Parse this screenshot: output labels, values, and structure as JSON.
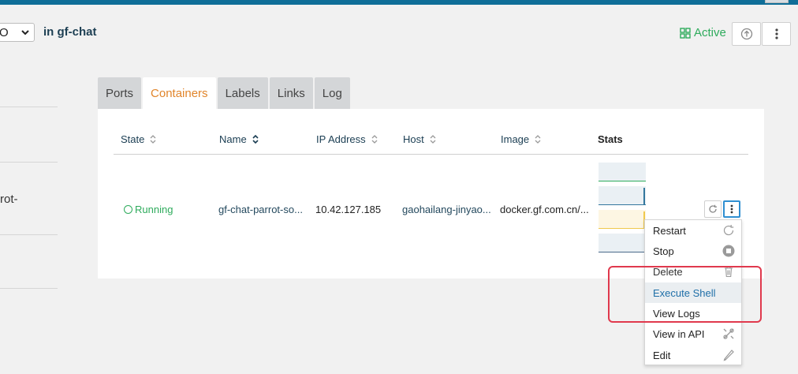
{
  "header": {
    "stack_select_value": "O",
    "in_label": "in",
    "stack_name": "gf-chat",
    "status": "Active",
    "status_color": "#2eab5c"
  },
  "left_panel": {
    "fragment": "rot-"
  },
  "tabs": [
    {
      "label": "Ports",
      "active": false
    },
    {
      "label": "Containers",
      "active": true
    },
    {
      "label": "Labels",
      "active": false
    },
    {
      "label": "Links",
      "active": false
    },
    {
      "label": "Log",
      "active": false
    }
  ],
  "table": {
    "columns": [
      {
        "label": "State",
        "sortable": true
      },
      {
        "label": "Name",
        "sortable": true
      },
      {
        "label": "IP Address",
        "sortable": true
      },
      {
        "label": "Host",
        "sortable": true
      },
      {
        "label": "Image",
        "sortable": true
      },
      {
        "label": "Stats",
        "sortable": false
      }
    ],
    "rows": [
      {
        "state": "Running",
        "name": "gf-chat-parrot-so...",
        "ip": "10.42.127.185",
        "host": "gaohailang-jinyao...",
        "image": "docker.gf.com.cn/..."
      }
    ]
  },
  "menu": {
    "items": [
      {
        "label": "Restart",
        "icon": "restart-icon"
      },
      {
        "label": "Stop",
        "icon": "stop-icon"
      },
      {
        "label": "Delete",
        "icon": "trash-icon"
      },
      {
        "label": "Execute Shell",
        "icon": "",
        "highlighted": true
      },
      {
        "label": "View Logs",
        "icon": ""
      },
      {
        "label": "View in API",
        "icon": "api-icon"
      },
      {
        "label": "Edit",
        "icon": "pencil-icon"
      }
    ]
  },
  "colors": {
    "accent": "#e1852b",
    "link": "#1d3f53",
    "highlight_box": "#e0394d",
    "topbar": "#0f6e98"
  }
}
